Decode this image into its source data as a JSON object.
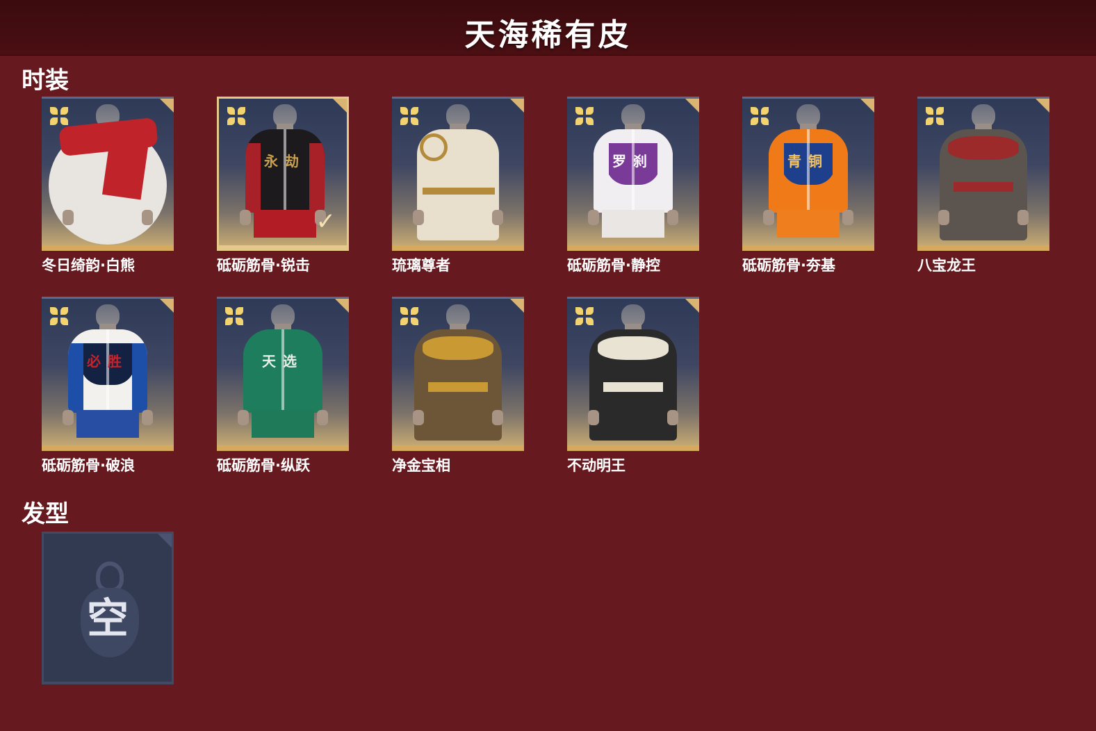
{
  "header": {
    "title": "天海稀有皮"
  },
  "sections": {
    "costumes": {
      "title": "时装",
      "items": [
        {
          "name": "冬日绮韵·白熊",
          "variant": "scarf",
          "colors": {
            "body": "#e8e4df",
            "accent": "#c0242a"
          }
        },
        {
          "name": "砥砺筋骨·锐击",
          "variant": "jacket",
          "selected": true,
          "chest_text": "永劫",
          "colors": {
            "body": "#1c1a1c",
            "arm": "#a82128",
            "chest_text": "#c9a14f",
            "pants": "#b21c24"
          }
        },
        {
          "name": "琉璃尊者",
          "variant": "robe",
          "colors": {
            "body": "#e8dfcc",
            "accent": "#b48b3a"
          }
        },
        {
          "name": "砥砺筋骨·静控",
          "variant": "jacket",
          "chest_text": "罗刹",
          "colors": {
            "body": "#f1eef2",
            "arm": "#f1eef2",
            "panel": "#7a3a98",
            "chest_text": "#ffffff",
            "pants": "#e9e6e4"
          }
        },
        {
          "name": "砥砺筋骨·夯基",
          "variant": "jacket",
          "chest_text": "青铜",
          "colors": {
            "body": "#f07a17",
            "arm": "#f07a17",
            "panel": "#1d3f8c",
            "chest_text": "#f5c56a",
            "pants": "#ef7f1e"
          }
        },
        {
          "name": "八宝龙王",
          "variant": "armor",
          "colors": {
            "body": "#5b544f",
            "accent": "#9c2a2a"
          }
        },
        {
          "name": "砥砺筋骨·破浪",
          "variant": "jacket",
          "chest_text": "必胜",
          "colors": {
            "body": "#f3f1ee",
            "arm": "#1e4fa8",
            "panel": "#132243",
            "chest_text": "#c8232a",
            "pants": "#274ea3"
          }
        },
        {
          "name": "砥砺筋骨·纵跃",
          "variant": "jacket",
          "chest_text": "天选",
          "colors": {
            "body": "#1d7d5c",
            "arm": "#1d7d5c",
            "chest_text": "#e9efe9",
            "pants": "#1e7a59"
          }
        },
        {
          "name": "净金宝相",
          "variant": "armor",
          "colors": {
            "body": "#6d5638",
            "accent": "#c99a33"
          }
        },
        {
          "name": "不动明王",
          "variant": "armor",
          "colors": {
            "body": "#2b2a2b",
            "accent": "#e9e3d4"
          }
        }
      ]
    },
    "hair": {
      "title": "发型",
      "items": [
        {
          "empty_text": "空"
        }
      ]
    }
  }
}
